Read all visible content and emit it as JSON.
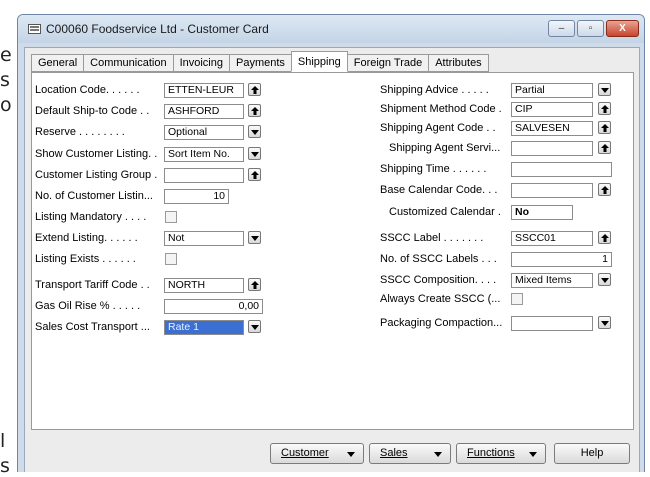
{
  "background_fragments": [
    "e",
    "s",
    "o",
    "l",
    "s"
  ],
  "window": {
    "title": "C00060 Foodservice Ltd - Customer Card",
    "minimize_label": "–",
    "maximize_label": "▫",
    "close_label": "X"
  },
  "tabs": [
    "General",
    "Communication",
    "Invoicing",
    "Payments",
    "Shipping",
    "Foreign Trade",
    "Attributes"
  ],
  "active_tab": "Shipping",
  "left_fields": {
    "location_code": {
      "label": "Location Code. . . . . .",
      "value": "ETTEN-LEUR"
    },
    "default_ship_to_code": {
      "label": "Default Ship-to Code  . .",
      "value": "ASHFORD"
    },
    "reserve": {
      "label": "Reserve . . . . . . . .",
      "value": "Optional"
    },
    "show_customer_listing": {
      "label": "Show Customer Listing. .",
      "value": "Sort Item No."
    },
    "customer_listing_group": {
      "label": "Customer Listing Group .",
      "value": ""
    },
    "no_of_customer_listing": {
      "label": "No. of Customer Listin...",
      "value": "10"
    },
    "listing_mandatory": {
      "label": "Listing Mandatory . . . .",
      "checked": false
    },
    "extend_listing": {
      "label": "Extend Listing. . . . . .",
      "value": "Not"
    },
    "listing_exists": {
      "label": "Listing Exists . . . . . .",
      "checked": false
    },
    "transport_tariff_code": {
      "label": "Transport Tariff Code . .",
      "value": "NORTH"
    },
    "gas_oil_rise": {
      "label": "Gas Oil Rise % . . . . .",
      "value": "0,00"
    },
    "sales_cost_transport": {
      "label": "Sales Cost Transport ...",
      "value": "Rate 1"
    }
  },
  "right_fields": {
    "shipping_advice": {
      "label": "Shipping Advice . . . . .",
      "value": "Partial"
    },
    "shipment_method_code": {
      "label": "Shipment Method Code  .",
      "value": "CIP"
    },
    "shipping_agent_code": {
      "label": "Shipping Agent Code  . .",
      "value": "SALVESEN"
    },
    "shipping_agent_service": {
      "label": "Shipping Agent Servi...",
      "value": ""
    },
    "shipping_time": {
      "label": "Shipping Time . . . . . .",
      "value": ""
    },
    "base_calendar_code": {
      "label": "Base Calendar Code. . .",
      "value": ""
    },
    "customized_calendar": {
      "label": "Customized Calendar  .",
      "value": "No"
    },
    "sscc_label": {
      "label": "SSCC Label . . . . . . .",
      "value": "SSCC01"
    },
    "no_of_sscc_labels": {
      "label": "No. of SSCC Labels  . . .",
      "value": "1"
    },
    "sscc_composition": {
      "label": "SSCC Composition. . . .",
      "value": "Mixed Items"
    },
    "always_create_sscc": {
      "label": "Always Create SSCC (...",
      "checked": false
    },
    "packaging_compaction": {
      "label": "Packaging Compaction...",
      "value": ""
    }
  },
  "buttons": {
    "customer": "Customer",
    "sales": "Sales",
    "functions": "Functions",
    "help": "Help"
  }
}
